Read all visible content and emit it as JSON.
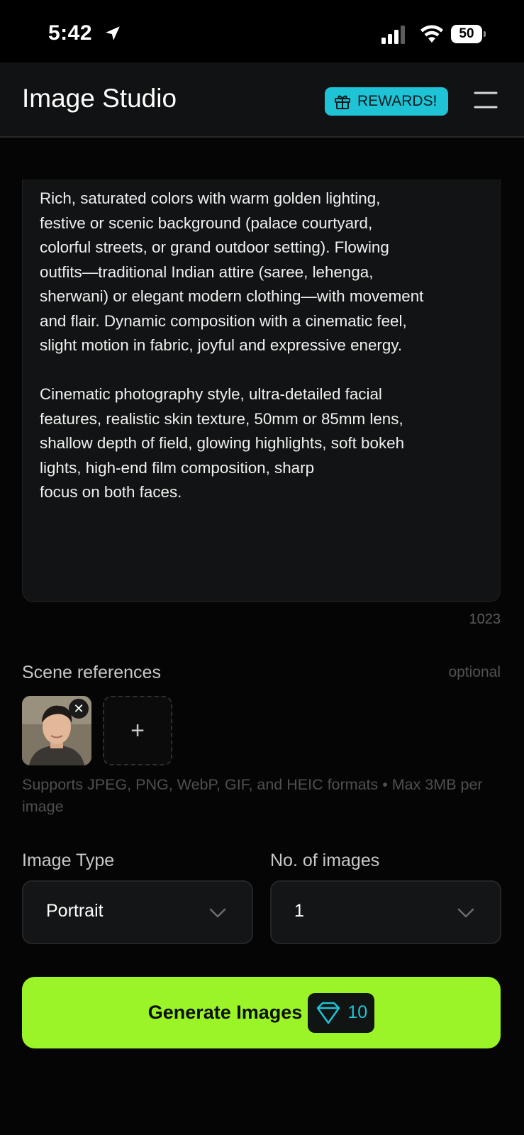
{
  "status_bar": {
    "time": "5:42",
    "battery": "50",
    "icons": [
      "location-icon",
      "signal-icon",
      "wifi-icon",
      "battery-icon"
    ]
  },
  "header": {
    "title": "Image Studio",
    "rewards_label": "REWARDS!",
    "icons": [
      "gift-icon",
      "menu-icon"
    ]
  },
  "prompt": {
    "text": "Rich, saturated colors with warm golden lighting,\nfestive or scenic background (palace courtyard,\ncolorful streets, or grand outdoor setting). Flowing\noutfits—traditional Indian attire (saree, lehenga,\nsherwani) or elegant modern clothing—with movement\nand flair. Dynamic composition with a cinematic feel,\nslight motion in fabric, joyful and expressive energy.\n\nCinematic photography style, ultra-detailed facial\nfeatures, realistic skin texture, 50mm or 85mm lens,\nshallow depth of field, glowing highlights, soft bokeh\nlights, high-end film composition, sharp\nfocus on both faces.",
    "char_count": "1023"
  },
  "scene_references": {
    "label": "Scene references",
    "optional": "optional",
    "remove_symbol": "✕",
    "add_symbol": "+",
    "formats_note": "Supports JPEG, PNG, WebP, GIF, and HEIC formats • Max 3MB per image"
  },
  "image_type": {
    "label": "Image Type",
    "value": "Portrait"
  },
  "num_images": {
    "label": "No. of images",
    "value": "1"
  },
  "generate": {
    "label": "Generate Images",
    "cost": "10"
  },
  "colors": {
    "accent_green": "#9af428",
    "accent_cyan": "#1fc3d6",
    "background": "#050505"
  }
}
